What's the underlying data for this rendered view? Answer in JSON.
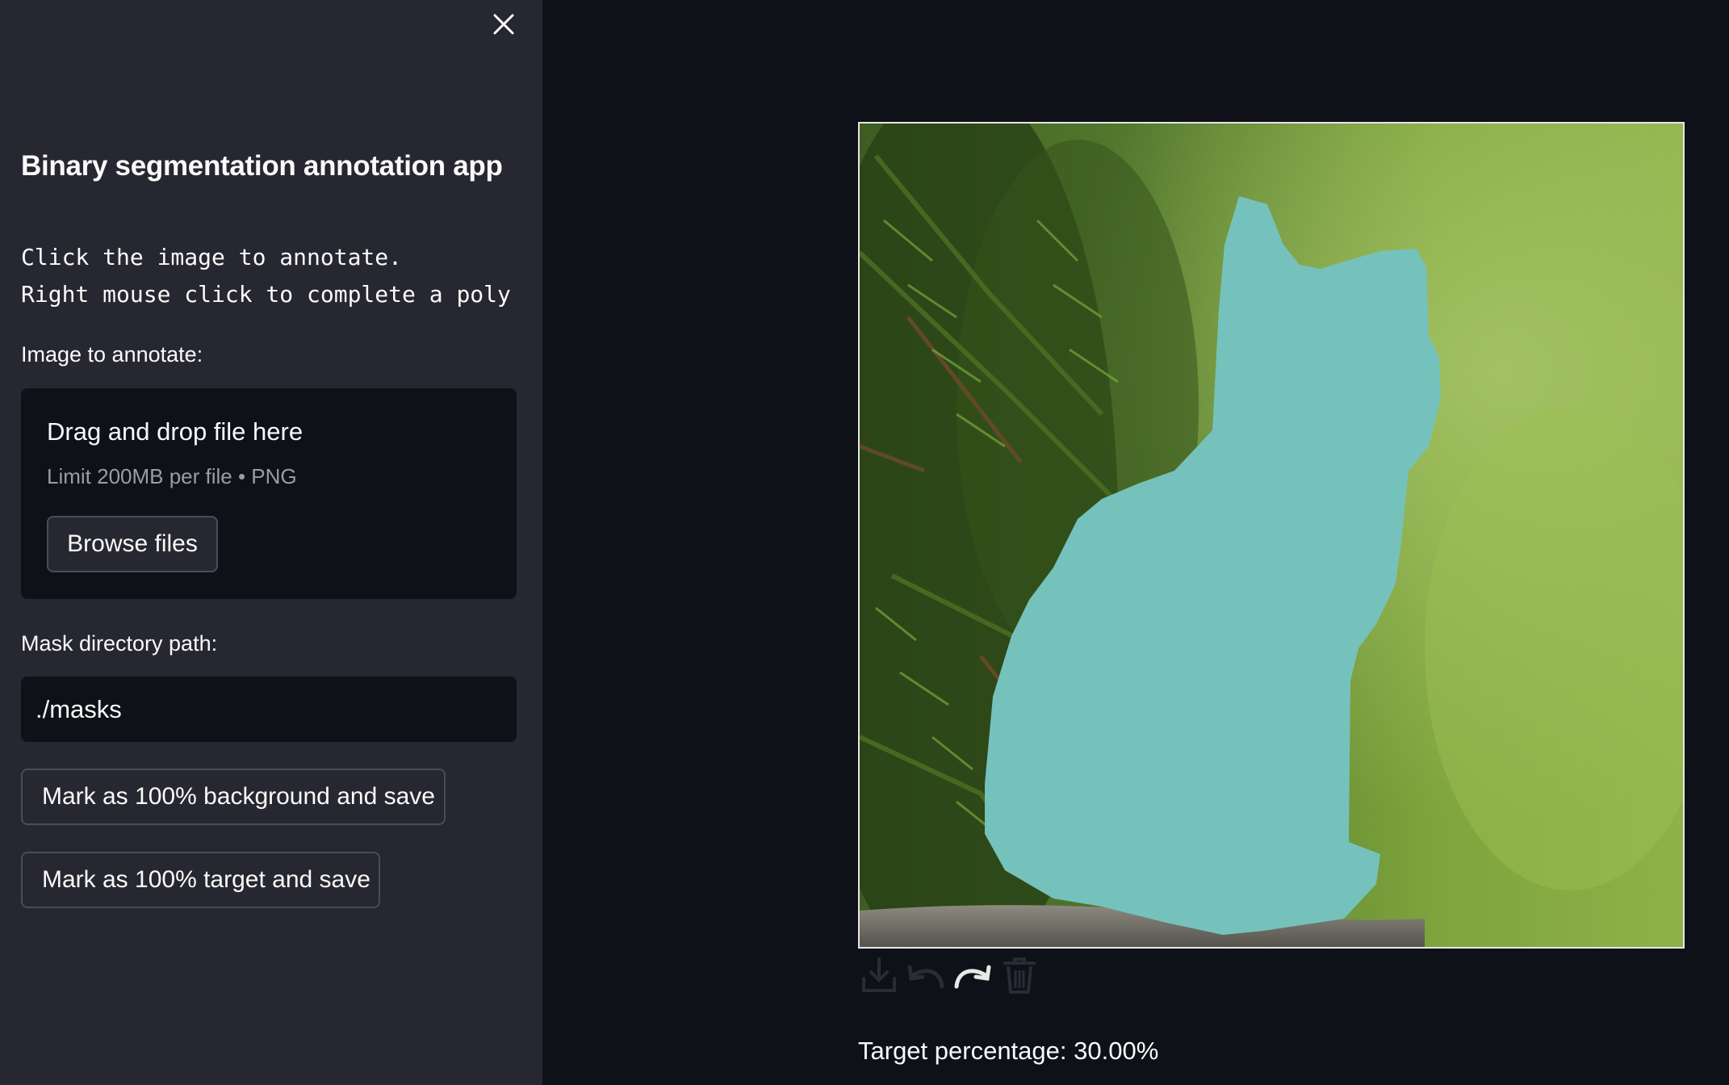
{
  "sidebar": {
    "close_icon": "close-icon",
    "title": "Binary segmentation annotation app",
    "instructions": "Click the image to annotate.\nRight mouse click to complete a poly",
    "image_label": "Image to annotate:",
    "uploader": {
      "title": "Drag and drop file here",
      "limit": "Limit 200MB per file • PNG",
      "browse_label": "Browse files"
    },
    "mask_label": "Mask directory path:",
    "mask_path": "./masks",
    "buttons": {
      "background": "Mark as 100% background and save",
      "target": "Mark as 100% target and save"
    }
  },
  "main": {
    "toolbar": [
      {
        "icon": "download-icon"
      },
      {
        "icon": "undo-icon"
      },
      {
        "icon": "redo-icon"
      },
      {
        "icon": "trash-icon"
      }
    ],
    "target_percentage": "Target percentage: 30.00%"
  },
  "colors": {
    "sidebar_bg": "#262730",
    "main_bg": "#0e1117",
    "mask_fill": "#75c2bc",
    "text": "#fafafa"
  }
}
